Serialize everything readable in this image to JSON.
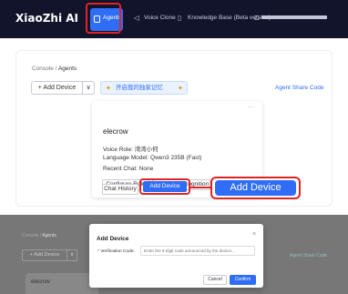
{
  "navbar": {
    "brand": "XiaoZhi AI",
    "agents_label": "Agents",
    "voice_clone_label": "Voice Clone",
    "knowledge_base_label": "Knowledge Base (Beta version)"
  },
  "breadcrumb": {
    "root": "Console",
    "separator": "/",
    "current": "Agents"
  },
  "toolbar": {
    "add_device": "+ Add Device",
    "dropdown_glyph": "∨",
    "memory_button": "开启我的独家记忆",
    "share_code": "Agent Share Code"
  },
  "agent_card": {
    "name": "elecrow",
    "more": "···",
    "voice_role": "Voice Role: 湾湾小何",
    "language_model": "Language Model: Qwen3 235B (Fast)",
    "recent_chat": "Recent Chat: None",
    "configure_role": "Configure Role",
    "speaker_recognition": "Speaker Recognition",
    "chat_history": "Chat History",
    "add_device": "Add Device"
  },
  "callout": {
    "label": "Add Device"
  },
  "modal_background": {
    "crumb_root": "Console",
    "crumb_current": "Agents",
    "add_device": "+ Add Device",
    "dropdown_glyph": "∨",
    "share_code": "Agent Share Code",
    "card_name": "elecrow"
  },
  "modal": {
    "title": "Add Device",
    "close": "×",
    "field_required": "*",
    "field_label": "Verification Code:",
    "field_placeholder": "Enter the 6-digit code announced by the device...",
    "cancel": "Cancel",
    "confirm": "Confirm"
  },
  "colors": {
    "navbar": "#12142c",
    "accent": "#2f6df6",
    "highlight": "#e02424"
  }
}
